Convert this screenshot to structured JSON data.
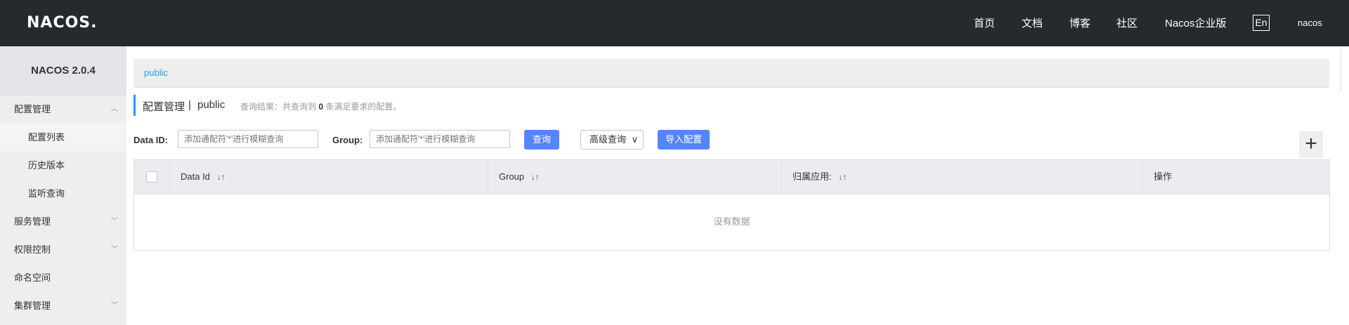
{
  "brand": {
    "logo_text": "NACOS."
  },
  "topnav": {
    "items": [
      "首页",
      "文档",
      "博客",
      "社区",
      "Nacos企业版"
    ],
    "lang": "En",
    "user": "nacos"
  },
  "sidebar": {
    "version": "NACOS 2.0.4",
    "groups": [
      {
        "label": "配置管理",
        "expanded": true
      },
      {
        "label": "服务管理",
        "expanded": false
      },
      {
        "label": "权限控制",
        "expanded": false
      },
      {
        "label": "命名空间"
      },
      {
        "label": "集群管理",
        "expanded": false
      }
    ],
    "config_sub": [
      "配置列表",
      "历史版本",
      "监听查询"
    ]
  },
  "breadcrumb": {
    "namespace": "public"
  },
  "page": {
    "title": "配置管理",
    "separator": "|",
    "namespace": "public",
    "result_prefix": "查询结果：共查询到",
    "result_count": "0",
    "result_suffix": "条满足要求的配置。"
  },
  "search": {
    "dataid_label": "Data ID:",
    "dataid_placeholder": "添加通配符'*'进行模糊查询",
    "group_label": "Group:",
    "group_placeholder": "添加通配符'*'进行模糊查询",
    "query_button": "查询",
    "advanced_button": "高级查询",
    "import_button": "导入配置",
    "add_symbol": "+"
  },
  "table": {
    "columns": [
      "Data Id",
      "Group",
      "归属应用:",
      "操作"
    ],
    "empty_text": "没有数据"
  },
  "colors": {
    "topbar": "#252a2f",
    "accent": "#209bfa",
    "primary_button": "#5584ff"
  }
}
